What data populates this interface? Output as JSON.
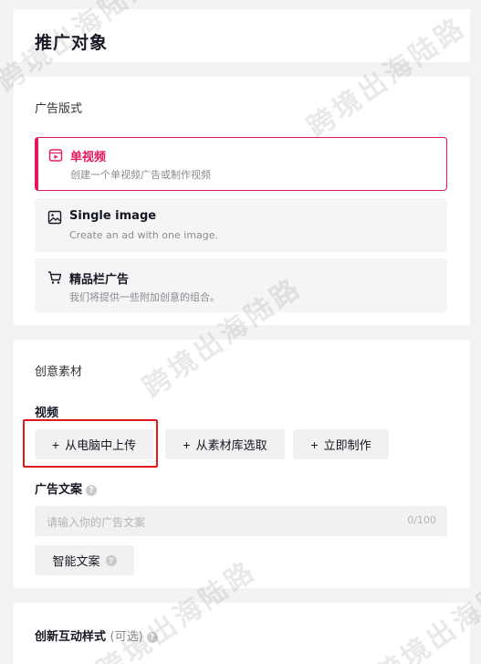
{
  "header": {
    "title": "推广对象"
  },
  "ad_format": {
    "section_title": "广告版式",
    "options": [
      {
        "title": "单视频",
        "desc": "创建一个单视频广告或制作视频",
        "icon": "video-icon",
        "selected": true
      },
      {
        "title": "Single image",
        "desc": "Create an ad with one image.",
        "icon": "image-icon",
        "selected": false
      },
      {
        "title": "精品栏广告",
        "desc": "我们将提供一些附加创意的组合。",
        "icon": "cart-icon",
        "selected": false
      }
    ]
  },
  "creative": {
    "section_title": "创意素材",
    "video_label": "视频",
    "buttons": {
      "upload": "从电脑中上传",
      "library": "从素材库选取",
      "create": "立即制作"
    },
    "ad_text_label": "广告文案",
    "ad_text_placeholder": "请输入你的广告文案",
    "ad_text_count": "0/100",
    "smart_text_label": "智能文案"
  },
  "interactive": {
    "title": "创新互动样式",
    "optional": "(可选)"
  },
  "watermark": {
    "text": "跨境出海陆路"
  },
  "colors": {
    "accent": "#e6185c",
    "highlight": "#e0191c"
  }
}
